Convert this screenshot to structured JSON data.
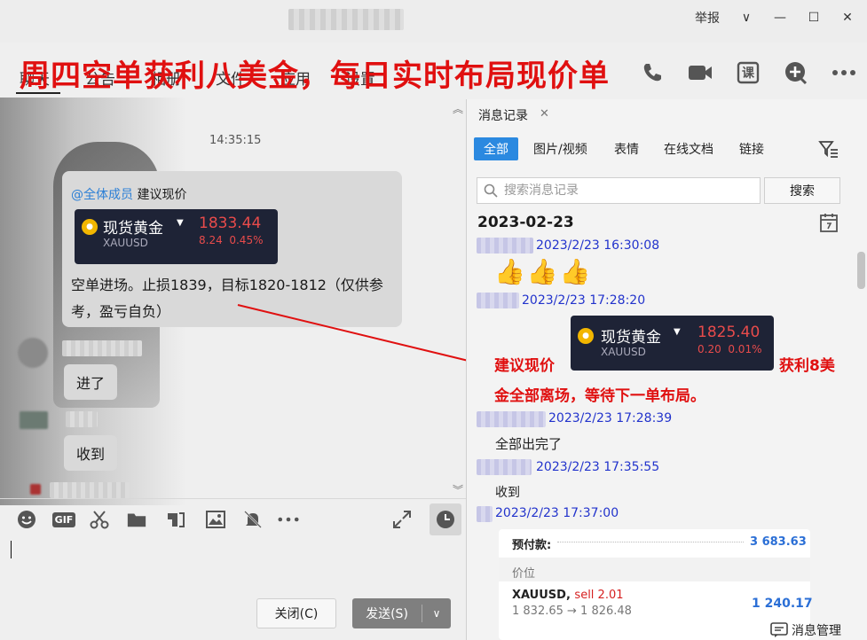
{
  "window": {
    "report_label": "举报",
    "controls": [
      "∨",
      "—",
      "☐",
      "✕"
    ]
  },
  "tabs": [
    {
      "label": "聊天"
    },
    {
      "label": "公告"
    },
    {
      "label": "相册"
    },
    {
      "label": "文件"
    },
    {
      "label": "应用"
    },
    {
      "label": "设置"
    }
  ],
  "overlay_headline": "周四空单获利八美金，每日实时布局现价单",
  "top_icons": [
    "phone-icon",
    "video-icon",
    "lesson-icon",
    "add-icon",
    "more-icon"
  ],
  "lesson_icon_text": "课",
  "chat": {
    "time": "14:35:15",
    "mention_at": "@全体成员",
    "mention_text": "建议现价",
    "quote": {
      "name": "现货黄金",
      "symbol": "XAUUSD",
      "price": "1833.44",
      "change": "8.24",
      "change_pct": "0.45%"
    },
    "main_message": "空单进场。止损1839，目标1820-1812（仅供参考，盈亏自负）",
    "reply1": "进了",
    "reply2": "收到"
  },
  "input_toolbar": {
    "gif_label": "GIF"
  },
  "buttons": {
    "close": "关闭(C)",
    "send": "发送(S)"
  },
  "history": {
    "title": "消息记录",
    "filters": [
      {
        "label": "全部",
        "active": true
      },
      {
        "label": "图片/视频"
      },
      {
        "label": "表情"
      },
      {
        "label": "在线文档"
      },
      {
        "label": "链接"
      }
    ],
    "search_placeholder": "搜索消息记录",
    "search_button": "搜索",
    "date": "2023-02-23",
    "entries": [
      {
        "time": "2023/2/23 16:30:08",
        "content": "👍👍👍"
      },
      {
        "time": "2023/2/23 17:28:20"
      },
      {
        "time": "2023/2/23 17:28:39",
        "content": "全部出完了"
      },
      {
        "time": "2023/2/23 17:35:55",
        "content": "收到"
      },
      {
        "time": "2023/2/23 17:37:00"
      }
    ],
    "quote": {
      "name": "现货黄金",
      "symbol": "XAUUSD",
      "price": "1825.40",
      "change": "0.20",
      "change_pct": "0.01%"
    },
    "annotation_left": "建议现价",
    "annotation_right": "获利8美",
    "annotation_line2": "金全部离场，等待下一单布局。",
    "trade_card": {
      "prepay_label": "预付款:",
      "prepay_value": "3 683.63",
      "price_label": "价位",
      "symbol": "XAUUSD,",
      "side": "sell 2.01",
      "price_move": "1 832.65 → 1 826.48",
      "profit": "1 240.17"
    },
    "manage_label": "消息管理"
  },
  "colors": {
    "headline_red": "#e01010",
    "accent_blue": "#2b89e0",
    "timestamp_blue": "#2233cc",
    "quote_bg": "#1e2336",
    "quote_red": "#e84b4b",
    "gold_coin": "#f2b600"
  }
}
